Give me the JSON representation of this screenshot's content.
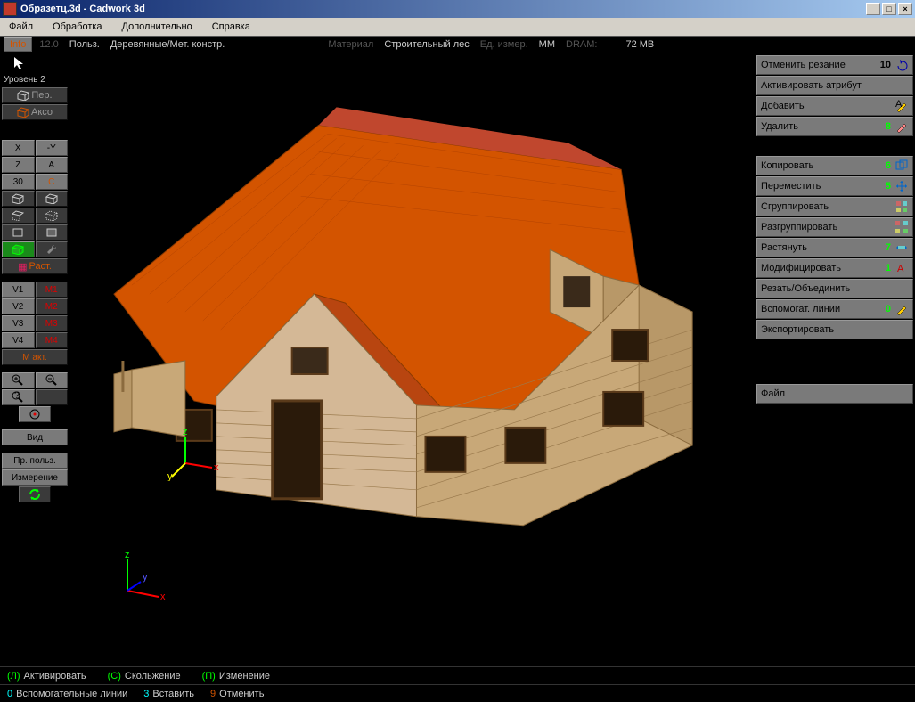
{
  "window": {
    "title": "Образетц.3d - Cadwork 3d"
  },
  "menu": {
    "file": "Файл",
    "edit": "Обработка",
    "extra": "Дополнительно",
    "help": "Справка"
  },
  "toolbar": {
    "info": "Info",
    "version": "12.0",
    "user": "Польз.",
    "mode": "Деревянные/Мет. констр.",
    "material": "Материал",
    "material_val": "Строительный лес",
    "units": "Ед. измер.",
    "units_val": "MM",
    "dram": "DRAM:",
    "mem": "72 MB"
  },
  "left": {
    "level": "Уровень 2",
    "per": "Пер.",
    "axo": "Аксо",
    "x": "X",
    "ny": "-Y",
    "z": "Z",
    "a": "A",
    "thirty": "30",
    "c": "C",
    "rast": "Раст.",
    "v1": "V1",
    "v2": "V2",
    "v3": "V3",
    "v4": "V4",
    "m1": "M1",
    "m2": "M2",
    "m3": "M3",
    "m4": "M4",
    "mlast": "М акт.",
    "view": "Вид",
    "pr_user": "Пр. польз.",
    "measure": "Измерение"
  },
  "right": {
    "undo_cut": "Отменить резание",
    "undo_cut_n": "10",
    "activate_attr": "Активировать атрибут",
    "add": "Добавить",
    "delete": "Удалить",
    "delete_n": "8",
    "copy": "Копировать",
    "copy_n": "6",
    "move": "Переместить",
    "move_n": "5",
    "group": "Сгруппировать",
    "ungroup": "Разгруппировать",
    "stretch": "Растянуть",
    "stretch_n": "7",
    "modify": "Модифицировать",
    "modify_n": "1",
    "cut_join": "Резать/Объединить",
    "aux_lines": "Вспомогат. линии",
    "aux_lines_n": "0",
    "export": "Экспортировать",
    "file": "Файл"
  },
  "status": {
    "a1_k": "(Л)",
    "a1": "Активировать",
    "a2_k": "(С)",
    "a2": "Скольжение",
    "a3_k": "(П)",
    "a3": "Изменение",
    "b1_k": "0",
    "b1": "Вспомогательные линии",
    "b2_k": "3",
    "b2": "Вставить",
    "b3_k": "9",
    "b3": "Отменить"
  }
}
